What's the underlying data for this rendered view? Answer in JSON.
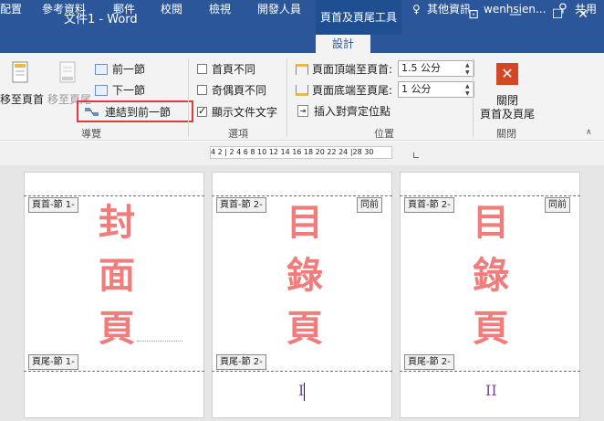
{
  "window": {
    "title": "文件1 - Word",
    "context_tab_header": "頁首及頁尾工具",
    "controls": {
      "restore": "⊡",
      "minimize": "—",
      "maximize": "☐",
      "close": "✕"
    }
  },
  "tabs": [
    {
      "label": "配置"
    },
    {
      "label": "參考資料"
    },
    {
      "label": "郵件"
    },
    {
      "label": "校閱"
    },
    {
      "label": "檢視"
    },
    {
      "label": "開發人員"
    },
    {
      "label": "設計"
    }
  ],
  "tell_me": {
    "label": "其他資訊",
    "icon": "lightbulb-icon"
  },
  "user": {
    "name": "wenhsien..."
  },
  "share": {
    "label": "共用",
    "icon": "person-add-icon"
  },
  "ribbon": {
    "navigation": {
      "group_label": "導覽",
      "goto_header": "移至頁首",
      "goto_footer": "移至頁尾",
      "previous": "前一節",
      "next": "下一節",
      "link_to_previous": "連結到前一節",
      "highlight_color": "#e23b3b"
    },
    "options": {
      "group_label": "選項",
      "different_first": {
        "label": "首頁不同",
        "checked": false
      },
      "different_odd_even": {
        "label": "奇偶頁不同",
        "checked": false
      },
      "show_document_text": {
        "label": "顯示文件文字",
        "checked": true
      }
    },
    "position": {
      "group_label": "位置",
      "header_from_top": {
        "label": "頁面頂端至頁首:",
        "value": "1.5 公分"
      },
      "footer_from_bottom": {
        "label": "頁面底端至頁尾:",
        "value": "1 公分"
      },
      "insert_alignment_tab": "插入對齊定位點"
    },
    "close": {
      "group_label": "關閉",
      "close_button_line1": "關閉",
      "close_button_line2": "頁首及頁尾",
      "accent": "#d24726"
    }
  },
  "ruler": {
    "text": "4 2 | 2  4  6  8 10 12 14 16 18 20 22 24 |28 30"
  },
  "pages": [
    {
      "header_tag": "頁首-節 1-",
      "footer_tag": "頁尾-節 1-",
      "same_as_previous": "",
      "big_text": [
        "封",
        "面",
        "頁"
      ],
      "page_number": ""
    },
    {
      "header_tag": "頁首-節 2-",
      "footer_tag": "頁尾-節 2-",
      "same_as_previous": "同前",
      "big_text": [
        "目",
        "錄",
        "頁"
      ],
      "page_number": "I"
    },
    {
      "header_tag": "頁首-節 2-",
      "footer_tag": "頁尾-節 2-",
      "same_as_previous": "同前",
      "big_text": [
        "目",
        "錄",
        "頁"
      ],
      "page_number": "II"
    }
  ],
  "colors": {
    "title_bar": "#2b579a",
    "big_text": "#f07c7c",
    "page_number": "#7a3fb0"
  }
}
